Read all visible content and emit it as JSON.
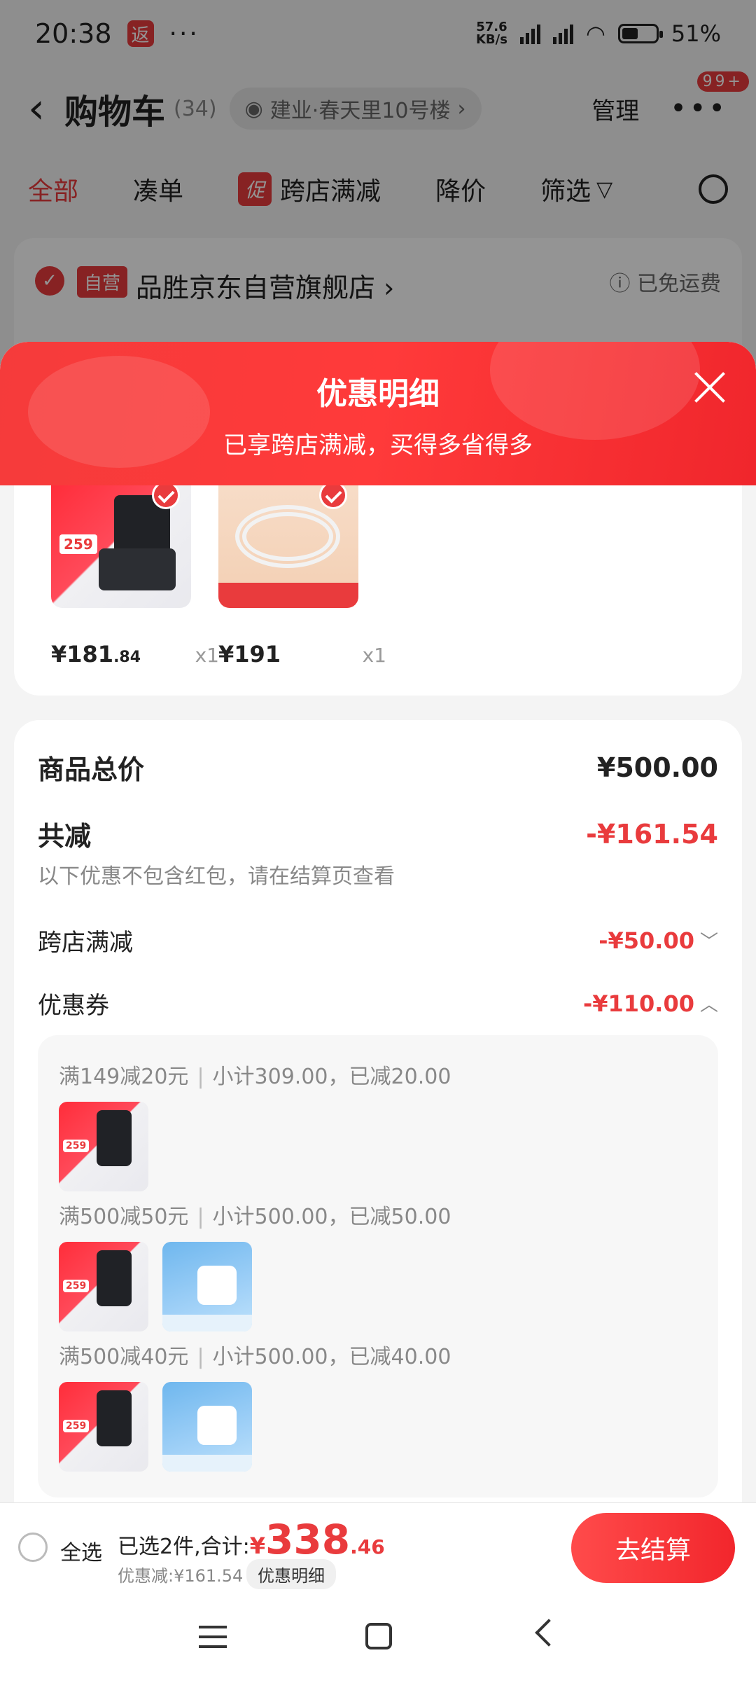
{
  "status_bar": {
    "time": "20:38",
    "app_badge": "返",
    "more": "···",
    "net_speed_top": "57.6",
    "net_speed_bottom": "KB/s",
    "battery": "51%"
  },
  "header": {
    "back_icon": "‹",
    "title": "购物车",
    "count": "(34)",
    "address": "建业·春天里10号楼",
    "address_chevron": "›",
    "manage": "管理",
    "msg_badge": "99+"
  },
  "filters": {
    "all": "全部",
    "combine": "凑单",
    "promo_tag": "促",
    "cross_store": "跨店满减",
    "price_drop": "降价",
    "filter": "筛选"
  },
  "store": {
    "self_tag": "自营",
    "name": "品胜京东自营旗舰店 ›",
    "shipping": "已免运费"
  },
  "panel": {
    "title": "优惠明细",
    "subtitle": "已享跨店满减，买得多省得多"
  },
  "items": [
    {
      "price_int": "¥181",
      "price_dec": ".84",
      "qty": "x1"
    },
    {
      "price_int": "¥191",
      "price_dec": "",
      "qty": "x1"
    }
  ],
  "summary": {
    "total_label": "商品总价",
    "total_value": "¥500.00",
    "reduce_label": "共减",
    "reduce_value": "-¥161.54",
    "note": "以下优惠不包含红包，请在结算页查看",
    "cross_label": "跨店满减",
    "cross_value": "-¥50.00",
    "cross_chevron": "﹀",
    "coupon_label": "优惠券",
    "coupon_value": "-¥110.00",
    "coupon_chevron": "︿"
  },
  "coupons": [
    {
      "rule": "满149减20元",
      "detail": "小计309.00，已减20.00"
    },
    {
      "rule": "满500减50元",
      "detail": "小计500.00，已减50.00"
    },
    {
      "rule": "满500减40元",
      "detail": "小计500.00，已减40.00"
    }
  ],
  "bottom": {
    "select_all": "全选",
    "selected_text": "已选2件,合计:",
    "currency": "¥",
    "total_int": "338",
    "total_dec": ".46",
    "discount": "优惠减:¥161.54",
    "detail_button": "优惠明细",
    "checkout": "去结算"
  },
  "colors": {
    "accent": "#e93b3d",
    "panel_head": "#f53b3b"
  }
}
